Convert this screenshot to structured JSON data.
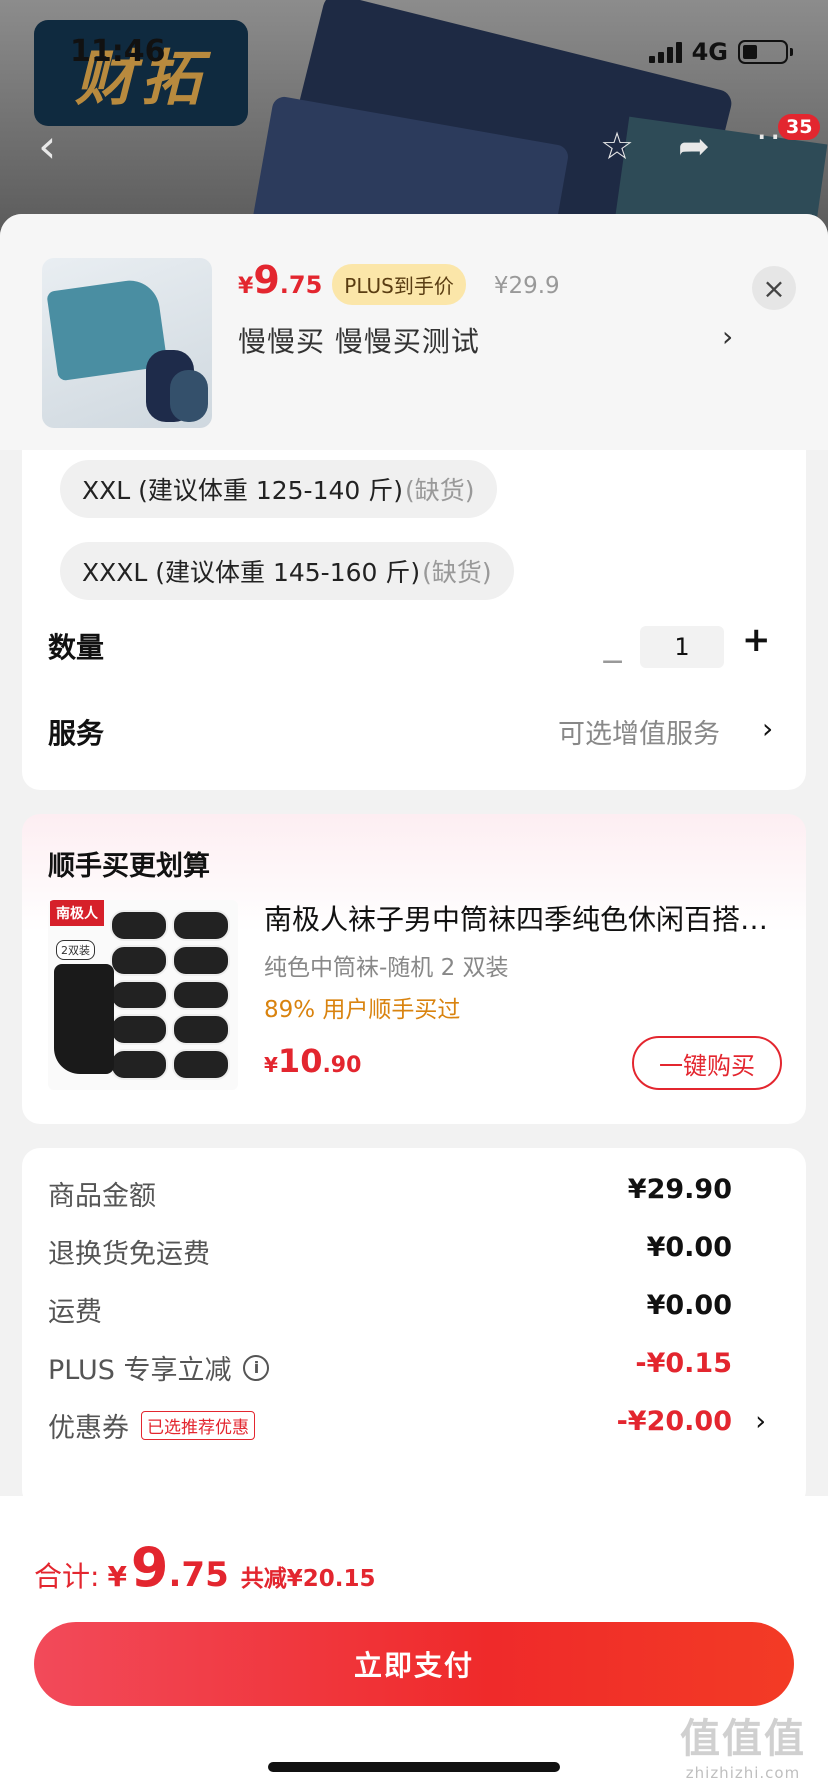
{
  "status_bar": {
    "time": "11:46",
    "network": "4G"
  },
  "banner": {
    "logo_text": "财拓",
    "cart_badge": "35"
  },
  "product": {
    "price_symbol": "¥",
    "price_int": "9",
    "price_dec": ".75",
    "plus_tag": "PLUS到手价",
    "original_price": "¥29.9",
    "subtitle": "慢慢买  慢慢买测试",
    "subtitle_chevron": "›",
    "close": "×"
  },
  "sizes": [
    {
      "label": "XXL (建议体重 125-140 斤)",
      "status": "(缺货)"
    },
    {
      "label": "XXXL (建议体重 145-160 斤)",
      "status": "(缺货)"
    }
  ],
  "quantity": {
    "label": "数量",
    "minus": "−",
    "value": "1",
    "plus": "+"
  },
  "service": {
    "label": "服务",
    "value": "可选增值服务",
    "chevron": "›"
  },
  "upsell": {
    "title": "顺手买更划算",
    "brand": "南极人",
    "pack_tag": "2双装",
    "name": "南极人袜子男中筒袜四季纯色休闲百搭运动",
    "spec": "纯色中筒袜-随机 2 双装",
    "rate": "89% 用户顺手买过",
    "price_symbol": "¥",
    "price_int": "10",
    "price_dec": ".90",
    "buy_label": "一键购买"
  },
  "summary": {
    "rows": [
      {
        "label": "商品金额",
        "value": "¥29.90"
      },
      {
        "label": "退换货免运费",
        "value": "¥0.00"
      },
      {
        "label": "运费",
        "value": "¥0.00"
      },
      {
        "label": "PLUS 专享立减",
        "value": "-¥0.15"
      },
      {
        "label": "优惠券",
        "tag": "已选推荐优惠",
        "value": "-¥20.00"
      }
    ]
  },
  "footer": {
    "total_label": "合计:",
    "total_symbol": "¥",
    "total_int": "9",
    "total_dec": ".75",
    "saved": "共减¥20.15",
    "pay_label": "立即支付",
    "watermark_big": "值值值",
    "watermark_small": "zhizhizhi.com"
  },
  "colors": {
    "accent": "#e3262f",
    "plus_tag_bg": "#fbe6a9",
    "rate_orange": "#d9830f"
  },
  "icons": [
    "back-arrow-icon",
    "star-icon",
    "share-icon",
    "more-icon",
    "close-icon",
    "info-icon",
    "chevron-right-icon"
  ]
}
